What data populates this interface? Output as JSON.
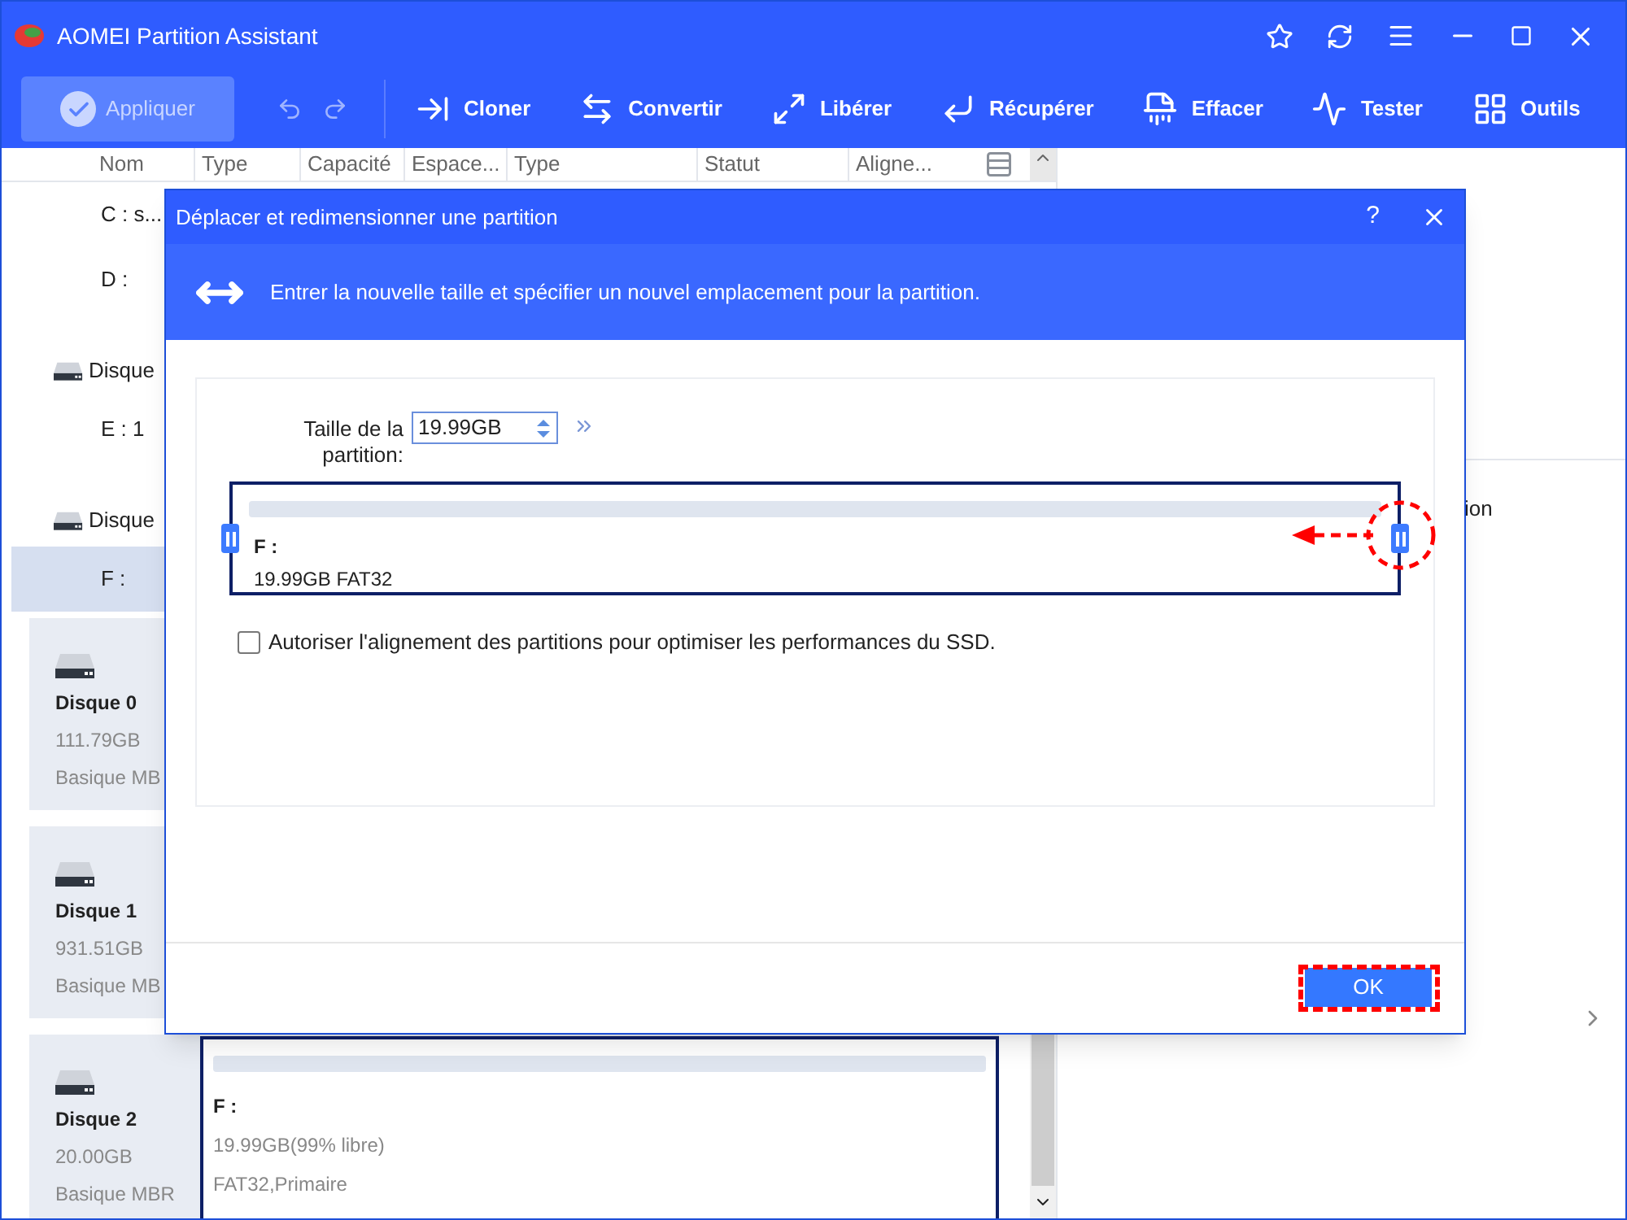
{
  "window": {
    "title": "AOMEI Partition Assistant"
  },
  "toolbar": {
    "apply": {
      "label": "Appliquer",
      "disabled": true
    },
    "tools": [
      {
        "kind": "clone",
        "label": "Cloner"
      },
      {
        "kind": "convert",
        "label": "Convertir"
      },
      {
        "kind": "free",
        "label": "Libérer"
      },
      {
        "kind": "recover",
        "label": "Récupérer"
      },
      {
        "kind": "wipe",
        "label": "Effacer"
      },
      {
        "kind": "test",
        "label": "Tester"
      },
      {
        "kind": "tools",
        "label": "Outils"
      }
    ]
  },
  "table": {
    "columns": [
      "Nom",
      "Type",
      "Capacité",
      "Espace...",
      "Type",
      "Statut",
      "Aligne..."
    ],
    "rows": [
      {
        "kind": "partition",
        "label": "C : s...",
        "selected": false
      },
      {
        "kind": "partition",
        "label": "D :",
        "selected": false
      },
      {
        "kind": "disk",
        "label": "Disque",
        "selected": false
      },
      {
        "kind": "partition",
        "label": "E : 1",
        "selected": false
      },
      {
        "kind": "disk",
        "label": "Disque",
        "selected": false
      },
      {
        "kind": "partition",
        "label": "F :",
        "selected": true
      }
    ]
  },
  "disks": [
    {
      "name": "Disque 0",
      "size": "111.79GB",
      "style": "Basique MB"
    },
    {
      "name": "Disque 1",
      "size": "931.51GB",
      "style": "Basique MB"
    },
    {
      "name": "Disque 2",
      "size": "20.00GB",
      "style": "Basique MBR",
      "partition": {
        "name": "F :",
        "free": "19.99GB(99% libre)",
        "info": "FAT32,Primaire"
      }
    }
  ],
  "right_pane": {
    "text": "ion"
  },
  "dialog": {
    "title": "Déplacer et redimensionner une partition",
    "help": "?",
    "instruction": "Entrer la nouvelle taille et spécifier un nouvel emplacement pour la partition.",
    "size_label": "Taille de la partition:",
    "size_value": "19.99GB",
    "partition": {
      "name": "F :",
      "info": "19.99GB FAT32"
    },
    "ssd_option": {
      "label": "Autoriser l'alignement des partitions pour optimiser les performances du SSD.",
      "checked": false
    },
    "ok": "OK"
  }
}
